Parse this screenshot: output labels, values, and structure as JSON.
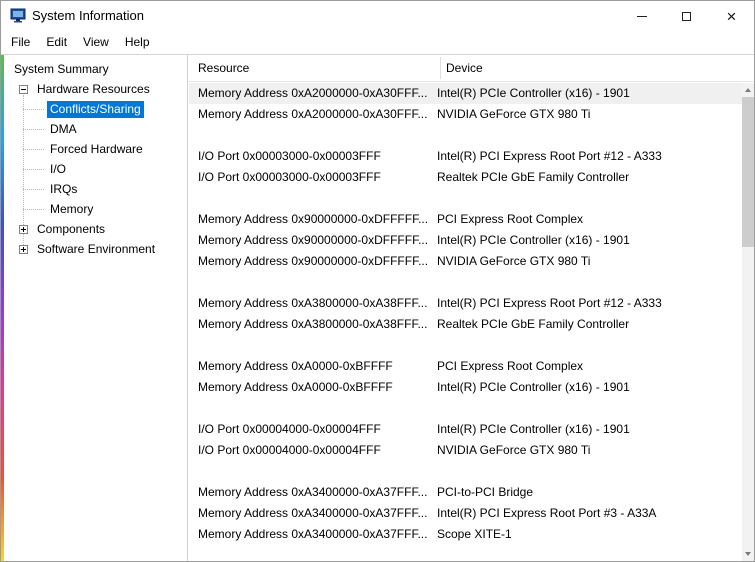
{
  "window": {
    "title": "System Information"
  },
  "titlebar": {
    "close_glyph": "×"
  },
  "menu": {
    "items": [
      {
        "label": "File"
      },
      {
        "label": "Edit"
      },
      {
        "label": "View"
      },
      {
        "label": "Help"
      }
    ]
  },
  "tree": {
    "items": [
      {
        "label": "System Summary",
        "level": 0,
        "expander": "none",
        "selected": false
      },
      {
        "label": "Hardware Resources",
        "level": 1,
        "expander": "minus",
        "selected": false
      },
      {
        "label": "Conflicts/Sharing",
        "level": 2,
        "expander": "none",
        "selected": true
      },
      {
        "label": "DMA",
        "level": 2,
        "expander": "none",
        "selected": false
      },
      {
        "label": "Forced Hardware",
        "level": 2,
        "expander": "none",
        "selected": false
      },
      {
        "label": "I/O",
        "level": 2,
        "expander": "none",
        "selected": false
      },
      {
        "label": "IRQs",
        "level": 2,
        "expander": "none",
        "selected": false
      },
      {
        "label": "Memory",
        "level": 2,
        "expander": "none",
        "selected": false
      },
      {
        "label": "Components",
        "level": 1,
        "expander": "plus",
        "selected": false
      },
      {
        "label": "Software Environment",
        "level": 1,
        "expander": "plus",
        "selected": false
      }
    ]
  },
  "table": {
    "columns": [
      "Resource",
      "Device"
    ],
    "highlighted_row_index": 0,
    "rows": [
      {
        "resource": "Memory Address 0xA2000000-0xA30FFF...",
        "device": "Intel(R) PCIe Controller (x16) - 1901"
      },
      {
        "resource": "Memory Address 0xA2000000-0xA30FFF...",
        "device": "NVIDIA GeForce GTX 980 Ti"
      },
      {
        "resource": "",
        "device": ""
      },
      {
        "resource": "I/O Port 0x00003000-0x00003FFF",
        "device": "Intel(R) PCI Express Root Port #12 - A333"
      },
      {
        "resource": "I/O Port 0x00003000-0x00003FFF",
        "device": "Realtek PCIe GbE Family Controller"
      },
      {
        "resource": "",
        "device": ""
      },
      {
        "resource": "Memory Address 0x90000000-0xDFFFFF...",
        "device": "PCI Express Root Complex"
      },
      {
        "resource": "Memory Address 0x90000000-0xDFFFFF...",
        "device": "Intel(R) PCIe Controller (x16) - 1901"
      },
      {
        "resource": "Memory Address 0x90000000-0xDFFFFF...",
        "device": "NVIDIA GeForce GTX 980 Ti"
      },
      {
        "resource": "",
        "device": ""
      },
      {
        "resource": "Memory Address 0xA3800000-0xA38FFF...",
        "device": "Intel(R) PCI Express Root Port #12 - A333"
      },
      {
        "resource": "Memory Address 0xA3800000-0xA38FFF...",
        "device": "Realtek PCIe GbE Family Controller"
      },
      {
        "resource": "",
        "device": ""
      },
      {
        "resource": "Memory Address 0xA0000-0xBFFFF",
        "device": "PCI Express Root Complex"
      },
      {
        "resource": "Memory Address 0xA0000-0xBFFFF",
        "device": "Intel(R) PCIe Controller (x16) - 1901"
      },
      {
        "resource": "",
        "device": ""
      },
      {
        "resource": "I/O Port 0x00004000-0x00004FFF",
        "device": "Intel(R) PCIe Controller (x16) - 1901"
      },
      {
        "resource": "I/O Port 0x00004000-0x00004FFF",
        "device": "NVIDIA GeForce GTX 980 Ti"
      },
      {
        "resource": "",
        "device": ""
      },
      {
        "resource": "Memory Address 0xA3400000-0xA37FFF...",
        "device": "PCI-to-PCI Bridge"
      },
      {
        "resource": "Memory Address 0xA3400000-0xA37FFF...",
        "device": "Intel(R) PCI Express Root Port #3 - A33A"
      },
      {
        "resource": "Memory Address 0xA3400000-0xA37FFF...",
        "device": "Scope XITE-1"
      }
    ]
  },
  "colors": {
    "selection_bg": "#0078d7",
    "selection_text": "#ffffff",
    "row_highlight": "#f0f0f0",
    "edge_strip": [
      "#5bbd4a",
      "#29a3e0",
      "#3f51c1",
      "#8e3fd1",
      "#d8408f",
      "#e8533f",
      "#f2d43c"
    ]
  }
}
